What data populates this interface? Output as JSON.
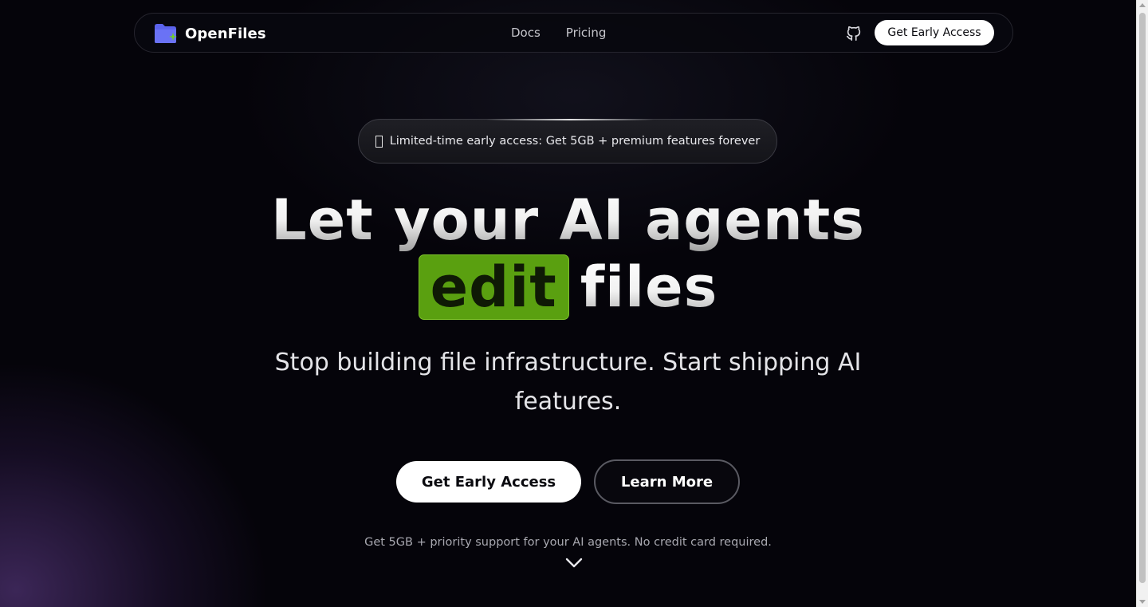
{
  "nav": {
    "brand_name": "OpenFiles",
    "links": [
      "Docs",
      "Pricing"
    ],
    "cta_label": "Get Early Access"
  },
  "announcement": {
    "text": "Limited-time early access: Get 5GB + premium features forever"
  },
  "hero": {
    "line1": "Let your AI agents",
    "highlight": "edit",
    "line2_rest": "files",
    "subhead": "Stop building file infrastructure. Start shipping AI features.",
    "primary_cta": "Get Early Access",
    "secondary_cta": "Learn More",
    "footnote": "Get 5GB + priority support for your AI agents. No credit card required."
  },
  "colors": {
    "background": "#05040a",
    "highlight_green": "#5aa010",
    "brand_folder": "#5b63ec",
    "sparkle_green": "#6fcf2a",
    "glow_purple": "#684296"
  },
  "icons": {
    "brand": "folder-sparkle-icon",
    "github": "github-icon",
    "announcement": "gift-icon",
    "scroll": "chevron-down-icon"
  }
}
